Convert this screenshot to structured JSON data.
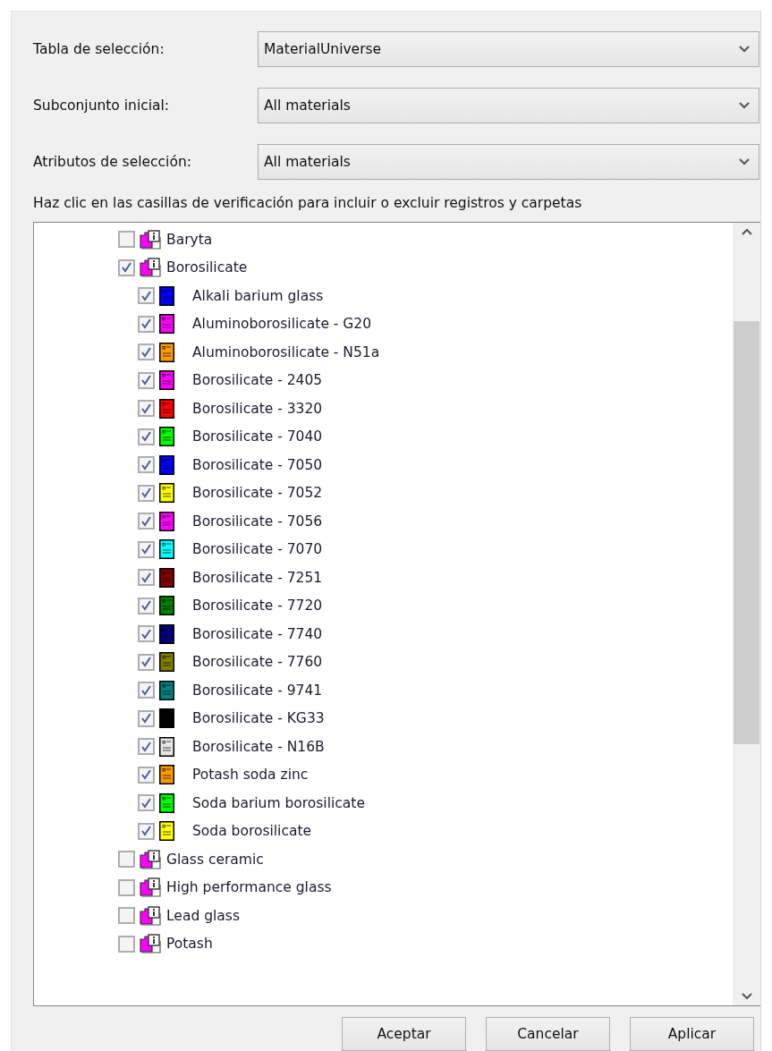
{
  "fields": [
    {
      "label": "Tabla de selección:",
      "value": "MaterialUniverse"
    },
    {
      "label": "Subconjunto inicial:",
      "value": "All materials"
    },
    {
      "label": "Atributos de selección:",
      "value": "All materials"
    }
  ],
  "instruction": "Haz clic en las casillas de verificación para incluir o excluir registros y carpetas",
  "tree": [
    {
      "label": "Baryta",
      "checked": false
    },
    {
      "label": "Borosilicate",
      "checked": true,
      "children": [
        {
          "label": "Alkali barium glass",
          "checked": true,
          "color": "#0000ff"
        },
        {
          "label": "Aluminoborosilicate - G20",
          "checked": true,
          "color": "#ff00ff"
        },
        {
          "label": "Aluminoborosilicate - N51a",
          "checked": true,
          "color": "#ff9900"
        },
        {
          "label": "Borosilicate - 2405",
          "checked": true,
          "color": "#ff00ff"
        },
        {
          "label": "Borosilicate - 3320",
          "checked": true,
          "color": "#ff0000"
        },
        {
          "label": "Borosilicate - 7040",
          "checked": true,
          "color": "#00ff00"
        },
        {
          "label": "Borosilicate - 7050",
          "checked": true,
          "color": "#0000ff"
        },
        {
          "label": "Borosilicate - 7052",
          "checked": true,
          "color": "#ffff00"
        },
        {
          "label": "Borosilicate - 7056",
          "checked": true,
          "color": "#ff00ff"
        },
        {
          "label": "Borosilicate - 7070",
          "checked": true,
          "color": "#00ffff"
        },
        {
          "label": "Borosilicate - 7251",
          "checked": true,
          "color": "#800000"
        },
        {
          "label": "Borosilicate - 7720",
          "checked": true,
          "color": "#008000"
        },
        {
          "label": "Borosilicate - 7740",
          "checked": true,
          "color": "#000080"
        },
        {
          "label": "Borosilicate - 7760",
          "checked": true,
          "color": "#808000"
        },
        {
          "label": "Borosilicate - 9741",
          "checked": true,
          "color": "#008080"
        },
        {
          "label": "Borosilicate - KG33",
          "checked": true,
          "color": "#000000"
        },
        {
          "label": "Borosilicate - N16B",
          "checked": true,
          "color": "#e6e6e6"
        },
        {
          "label": "Potash soda zinc",
          "checked": true,
          "color": "#ff9900"
        },
        {
          "label": "Soda barium borosilicate",
          "checked": true,
          "color": "#00ff00"
        },
        {
          "label": "Soda borosilicate",
          "checked": true,
          "color": "#ffff00"
        }
      ]
    },
    {
      "label": "Glass ceramic",
      "checked": false
    },
    {
      "label": "High performance glass",
      "checked": false
    },
    {
      "label": "Lead glass",
      "checked": false
    },
    {
      "label": "Potash",
      "checked": false
    }
  ],
  "buttons": [
    "Aceptar",
    "Cancelar",
    "Aplicar"
  ]
}
